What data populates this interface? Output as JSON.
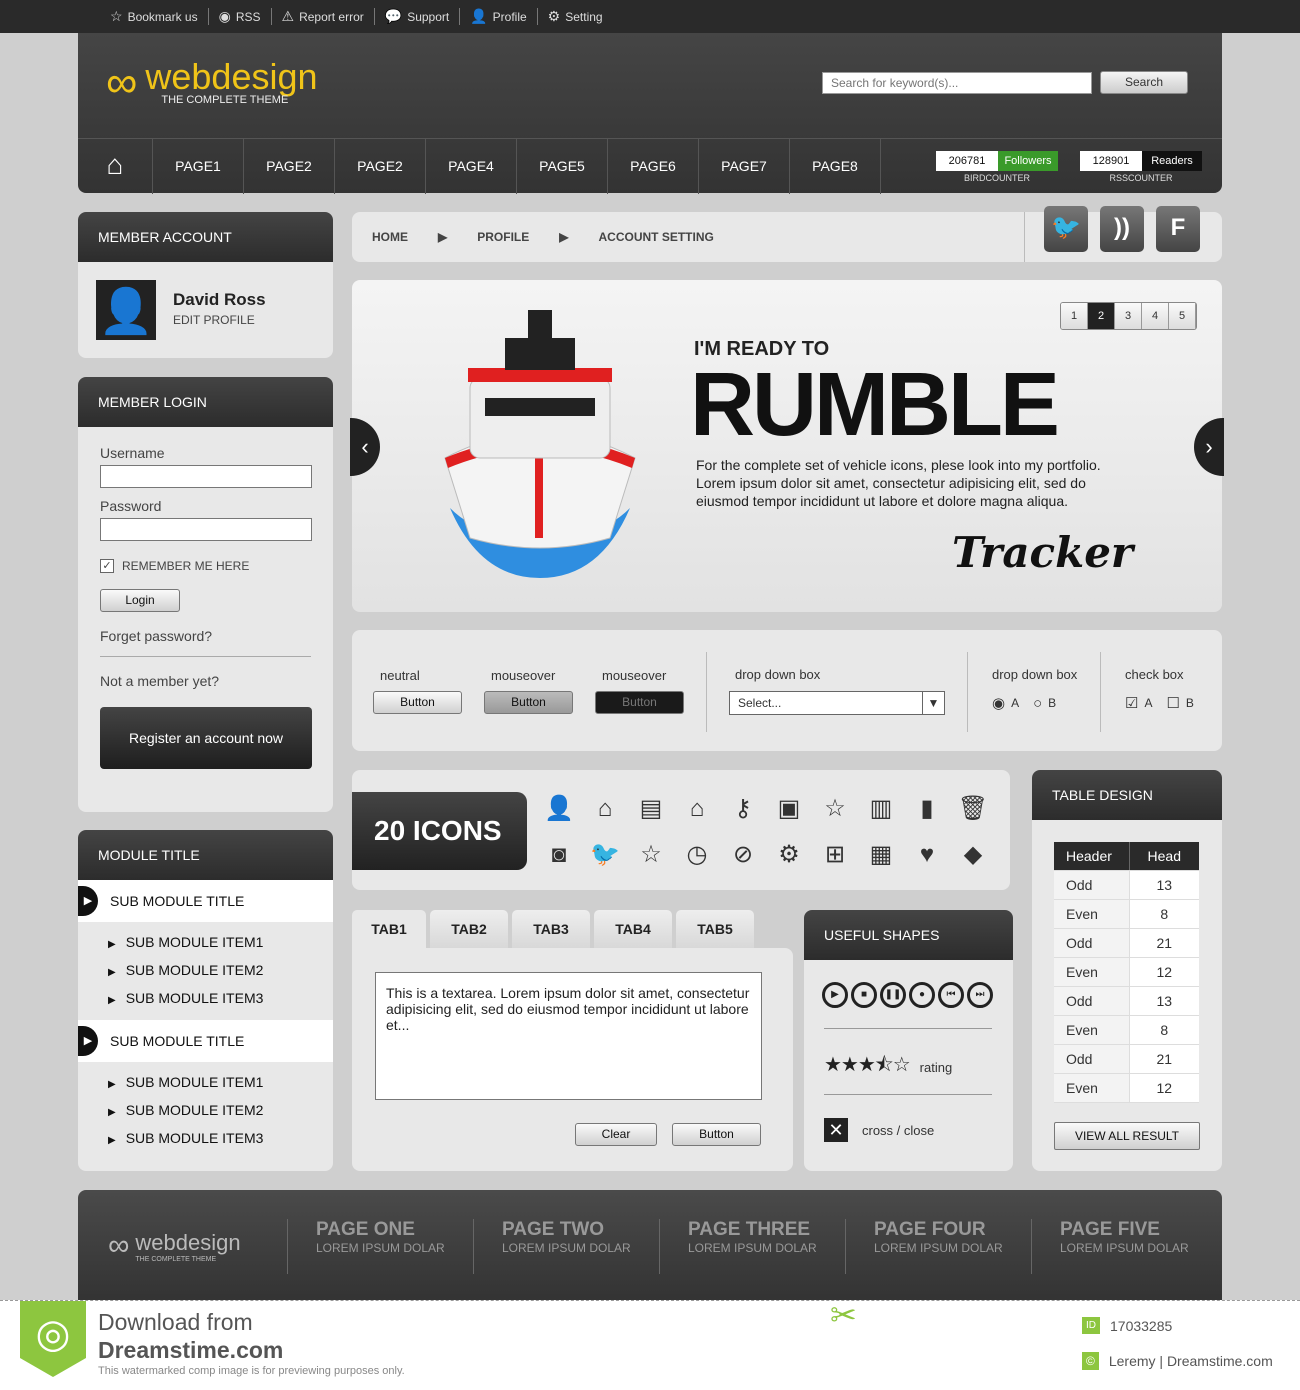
{
  "topbar": [
    {
      "icon": "star-icon",
      "label": "Bookmark us"
    },
    {
      "icon": "rss-icon",
      "label": "RSS"
    },
    {
      "icon": "warning-icon",
      "label": "Report error"
    },
    {
      "icon": "chat-icon",
      "label": "Support"
    },
    {
      "icon": "user-icon",
      "label": "Profile"
    },
    {
      "icon": "gear-icon",
      "label": "Setting"
    }
  ],
  "logo": {
    "name": "webdesign",
    "tagline": "THE COMPLETE THEME"
  },
  "search": {
    "placeholder": "Search for keyword(s)...",
    "button": "Search"
  },
  "nav": [
    "PAGE1",
    "PAGE2",
    "PAGE2",
    "PAGE4",
    "PAGE5",
    "PAGE6",
    "PAGE7",
    "PAGE8"
  ],
  "counters": {
    "bird": {
      "value": "206781",
      "label": "Followers",
      "caption": "BIRDCOUNTER"
    },
    "rss": {
      "value": "128901",
      "label": "Readers",
      "caption": "RSSCOUNTER"
    }
  },
  "account": {
    "title": "MEMBER ACCOUNT",
    "name": "David Ross",
    "link": "EDIT PROFILE"
  },
  "login": {
    "title": "MEMBER LOGIN",
    "username": "Username",
    "password": "Password",
    "remember": "REMEMBER ME HERE",
    "login": "Login",
    "forgot": "Forget password?",
    "notmember": "Not a member yet?",
    "register": "Register an account now"
  },
  "module": {
    "title": "MODULE TITLE",
    "groups": [
      {
        "title": "SUB MODULE TITLE",
        "items": [
          "SUB MODULE ITEM1",
          "SUB MODULE ITEM2",
          "SUB MODULE ITEM3"
        ]
      },
      {
        "title": "SUB MODULE TITLE",
        "items": [
          "SUB MODULE ITEM1",
          "SUB MODULE ITEM2",
          "SUB MODULE ITEM3"
        ]
      }
    ]
  },
  "breadcrumb": [
    "HOME",
    "PROFILE",
    "ACCOUNT SETTING"
  ],
  "social": [
    {
      "icon": "bird-icon",
      "glyph": "🐦"
    },
    {
      "icon": "rss-icon",
      "glyph": "))"
    },
    {
      "icon": "facebook-icon",
      "glyph": "F"
    }
  ],
  "slider": {
    "pages": [
      "1",
      "2",
      "3",
      "4",
      "5"
    ],
    "active": 2,
    "kicker": "I'M READY TO",
    "headline": "RUMBLE",
    "body": "For the complete set of vehicle icons, plese look into my portfolio. Lorem ipsum dolor sit amet, consectetur adipisicing elit, sed do eiusmod tempor incididunt ut labore et dolore magna aliqua.",
    "signature": "Tracker"
  },
  "controls": {
    "neutral": "neutral",
    "mouseover1": "mouseover",
    "mouseover2": "mouseover",
    "button": "Button",
    "dropdown_label": "drop down box",
    "select": "Select...",
    "radio_label": "drop down box",
    "radio_a": "A",
    "radio_b": "B",
    "check_label": "check box",
    "check_a": "A",
    "check_b": "B"
  },
  "icons": {
    "title": "20 ICONS",
    "list": [
      [
        "user-icon",
        "👤"
      ],
      [
        "home-icon",
        "⌂"
      ],
      [
        "document-icon",
        "▤"
      ],
      [
        "house-user-icon",
        "⌂"
      ],
      [
        "key-icon",
        "⚷"
      ],
      [
        "camera-icon",
        "▣"
      ],
      [
        "star-icon",
        "☆"
      ],
      [
        "book-icon",
        "▥"
      ],
      [
        "bar-chart-icon",
        "▮"
      ],
      [
        "trash-icon",
        "🗑"
      ],
      [
        "rss-icon",
        "◙"
      ],
      [
        "bird-icon",
        "🐦"
      ],
      [
        "star-outline-icon",
        "☆"
      ],
      [
        "clock-icon",
        "◷"
      ],
      [
        "ban-icon",
        "⊘"
      ],
      [
        "gear-icon",
        "⚙"
      ],
      [
        "sitemap-icon",
        "⊞"
      ],
      [
        "calendar-icon",
        "▦"
      ],
      [
        "heart-icon",
        "♥"
      ],
      [
        "tag-icon",
        "◆"
      ]
    ]
  },
  "tabs": {
    "labels": [
      "TAB1",
      "TAB2",
      "TAB3",
      "TAB4",
      "TAB5"
    ],
    "textarea": "This is a textarea. Lorem ipsum dolor sit amet, consectetur adipisicing elit, sed do eiusmod tempor incididunt ut labore et...",
    "clear": "Clear",
    "button": "Button"
  },
  "shapes": {
    "title": "USEFUL SHAPES",
    "media": [
      "▶",
      "■",
      "❚❚",
      "●",
      "⏮",
      "⏭"
    ],
    "rating": 3.5,
    "rating_label": "rating",
    "close_label": "cross / close"
  },
  "table": {
    "title": "TABLE DESIGN",
    "headers": [
      "Header",
      "Head"
    ],
    "rows": [
      [
        "Odd",
        "13"
      ],
      [
        "Even",
        "8"
      ],
      [
        "Odd",
        "21"
      ],
      [
        "Even",
        "12"
      ],
      [
        "Odd",
        "13"
      ],
      [
        "Even",
        "8"
      ],
      [
        "Odd",
        "21"
      ],
      [
        "Even",
        "12"
      ]
    ],
    "button": "VIEW ALL RESULT"
  },
  "footer": {
    "logo": "webdesign",
    "tagline": "THE COMPLETE THEME",
    "cols": [
      {
        "h": "PAGE ONE",
        "s": "LOREM IPSUM DOLAR"
      },
      {
        "h": "PAGE TWO",
        "s": "LOREM IPSUM DOLAR"
      },
      {
        "h": "PAGE THREE",
        "s": "LOREM IPSUM DOLAR"
      },
      {
        "h": "PAGE FOUR",
        "s": "LOREM IPSUM DOLAR"
      },
      {
        "h": "PAGE FIVE",
        "s": "LOREM IPSUM DOLAR"
      }
    ]
  },
  "watermark": {
    "line1": "Download from",
    "line2": "Dreamstime.com",
    "note": "This watermarked comp image is for previewing purposes only.",
    "id": "17033285",
    "credit": "Leremy | Dreamstime.com"
  },
  "colors": {
    "accent": "#f0c419",
    "dark": "#2a2a2a",
    "green": "#3a9a2a",
    "brand_green": "#8dc63f"
  }
}
